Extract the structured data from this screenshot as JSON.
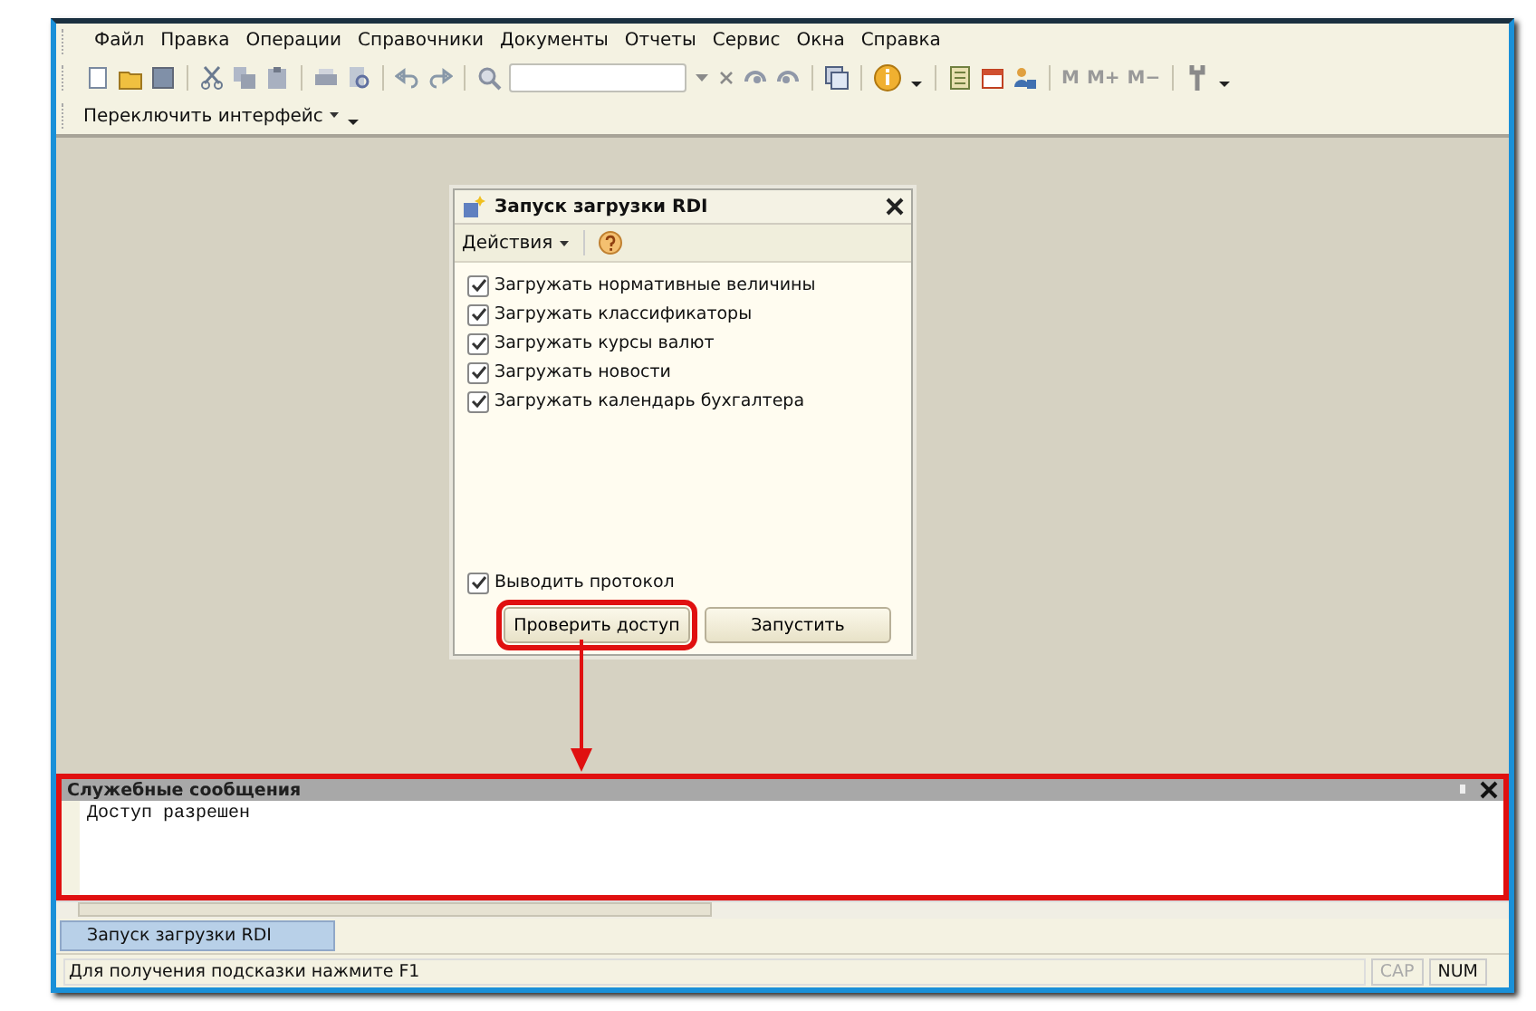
{
  "menu": [
    "Файл",
    "Правка",
    "Операции",
    "Справочники",
    "Документы",
    "Отчеты",
    "Сервис",
    "Окна",
    "Справка"
  ],
  "toolbar": {
    "memory_buttons": [
      "M",
      "M+",
      "M−"
    ]
  },
  "interface_switch": "Переключить интерфейс",
  "dialog": {
    "title": "Запуск загрузки RDI",
    "actions_menu": "Действия",
    "options": [
      {
        "label": "Загружать нормативные величины",
        "checked": true
      },
      {
        "label": "Загружать классификаторы",
        "checked": true
      },
      {
        "label": "Загружать курсы валют",
        "checked": true
      },
      {
        "label": "Загружать новости",
        "checked": true
      },
      {
        "label": "Загружать календарь бухгалтера",
        "checked": true
      }
    ],
    "protocol": {
      "label": "Выводить протокол",
      "checked": true
    },
    "buttons": [
      {
        "label": "Проверить доступ",
        "highlighted": true
      },
      {
        "label": "Запустить",
        "highlighted": false
      }
    ]
  },
  "messages": {
    "title": "Служебные сообщения",
    "highlighted": true,
    "lines": [
      "Доступ разрешен"
    ]
  },
  "taskbar": [
    {
      "label": "Запуск загрузки RDI",
      "selected": true
    }
  ],
  "status_bar": {
    "hint": "Для получения подсказки нажмите F1",
    "indicators": [
      {
        "label": "CAP",
        "on": false
      },
      {
        "label": "NUM",
        "on": true
      }
    ]
  }
}
